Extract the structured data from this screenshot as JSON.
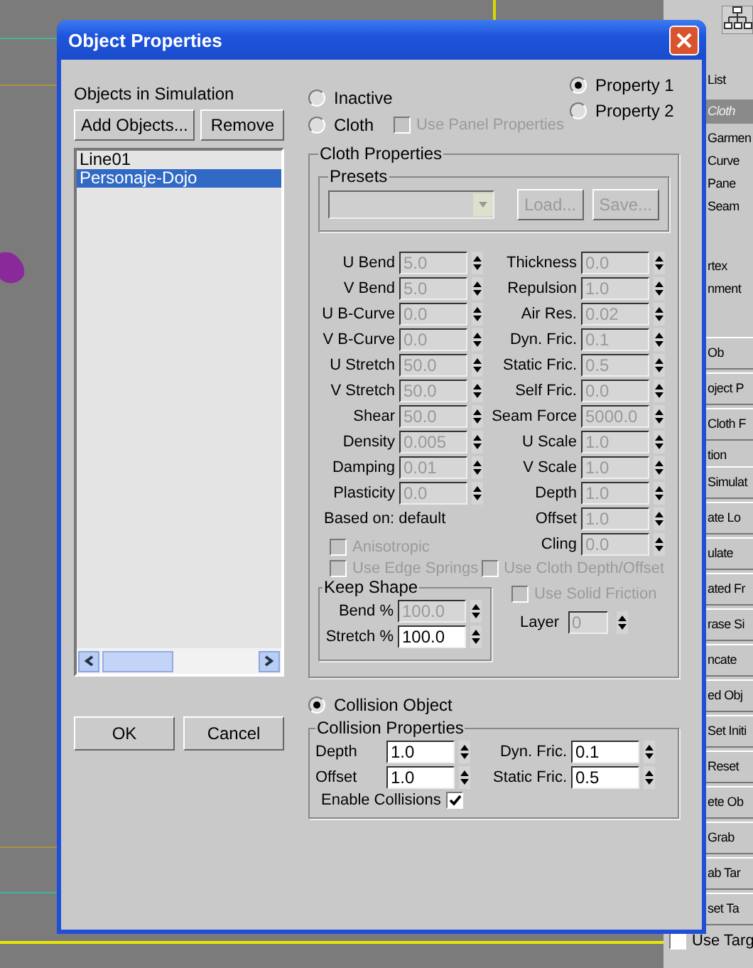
{
  "window": {
    "title": "Object Properties"
  },
  "objects": {
    "title": "Objects in Simulation",
    "buttons": [
      "Add Objects...",
      "Remove"
    ],
    "items": [
      {
        "label": "Line01",
        "selected": false
      },
      {
        "label": "Personaje-Dojo",
        "selected": true
      }
    ]
  },
  "dialog_buttons": [
    "OK",
    "Cancel"
  ],
  "mode_radios": [
    {
      "label": "Inactive",
      "selected": false
    },
    {
      "label": "Cloth",
      "selected": false
    },
    {
      "label": "Collision Object",
      "selected": true
    }
  ],
  "use_panel_properties": {
    "label": "Use Panel Properties",
    "checked": false,
    "disabled": true
  },
  "property_radios": [
    {
      "label": "Property 1",
      "selected": true
    },
    {
      "label": "Property 2",
      "selected": false
    }
  ],
  "cloth_properties": {
    "title": "Cloth Properties",
    "presets": {
      "title": "Presets",
      "buttons": [
        "Load...",
        "Save..."
      ]
    },
    "left_fields": [
      {
        "label": "U Bend",
        "value": "5.0",
        "disabled": true
      },
      {
        "label": "V Bend",
        "value": "5.0",
        "disabled": true
      },
      {
        "label": "U B-Curve",
        "value": "0.0",
        "disabled": true
      },
      {
        "label": "V B-Curve",
        "value": "0.0",
        "disabled": true
      },
      {
        "label": "U Stretch",
        "value": "50.0",
        "disabled": true
      },
      {
        "label": "V Stretch",
        "value": "50.0",
        "disabled": true
      },
      {
        "label": "Shear",
        "value": "50.0",
        "disabled": true
      },
      {
        "label": "Density",
        "value": "0.005",
        "disabled": true
      },
      {
        "label": "Damping",
        "value": "0.01",
        "disabled": true
      },
      {
        "label": "Plasticity",
        "value": "0.0",
        "disabled": true
      }
    ],
    "based_on": "Based on: default",
    "anisotropic": {
      "label": "Anisotropic",
      "checked": false,
      "disabled": true
    },
    "right_fields": [
      {
        "label": "Thickness",
        "value": "0.0",
        "disabled": true
      },
      {
        "label": "Repulsion",
        "value": "1.0",
        "disabled": true
      },
      {
        "label": "Air Res.",
        "value": "0.02",
        "disabled": true
      },
      {
        "label": "Dyn. Fric.",
        "value": "0.1",
        "disabled": true
      },
      {
        "label": "Static Fric.",
        "value": "0.5",
        "disabled": true
      },
      {
        "label": "Self Fric.",
        "value": "0.0",
        "disabled": true
      },
      {
        "label": "Seam Force",
        "value": "5000.0",
        "disabled": true
      },
      {
        "label": "U Scale",
        "value": "1.0",
        "disabled": true
      },
      {
        "label": "V Scale",
        "value": "1.0",
        "disabled": true
      },
      {
        "label": "Depth",
        "value": "1.0",
        "disabled": true
      },
      {
        "label": "Offset",
        "value": "1.0",
        "disabled": true
      },
      {
        "label": "Cling",
        "value": "0.0",
        "disabled": true
      }
    ],
    "edge_springs": {
      "label": "Use Edge Springs",
      "checked": false,
      "disabled": true
    },
    "cloth_depth_offset": {
      "label": "Use Cloth Depth/Offset",
      "checked": false,
      "disabled": true
    },
    "keep_shape": {
      "title": "Keep Shape",
      "fields": [
        {
          "label": "Bend %",
          "value": "100.0",
          "disabled": true
        },
        {
          "label": "Stretch %",
          "value": "100.0",
          "disabled": false
        }
      ]
    },
    "solid_friction": {
      "label": "Use Solid Friction",
      "checked": false,
      "disabled": true
    },
    "layer": {
      "label": "Layer",
      "value": "0",
      "disabled": true
    }
  },
  "collision_properties": {
    "title": "Collision Properties",
    "left_fields": [
      {
        "label": "Depth",
        "value": "1.0",
        "disabled": false
      },
      {
        "label": "Offset",
        "value": "1.0",
        "disabled": false
      }
    ],
    "right_fields": [
      {
        "label": "Dyn. Fric.",
        "value": "0.1",
        "disabled": false
      },
      {
        "label": "Static Fric.",
        "value": "0.5",
        "disabled": false
      }
    ],
    "enable_collisions": {
      "label": "Enable Collisions",
      "checked": true,
      "disabled": false
    }
  },
  "side_panel": [
    {
      "kind": "text",
      "label": "List"
    },
    {
      "kind": "header",
      "label": "Cloth"
    },
    {
      "kind": "text",
      "label": "Garmen"
    },
    {
      "kind": "text",
      "label": "Curve"
    },
    {
      "kind": "text",
      "label": "Pane"
    },
    {
      "kind": "text",
      "label": "Seam"
    },
    {
      "kind": "gap"
    },
    {
      "kind": "text",
      "label": "rtex"
    },
    {
      "kind": "text",
      "label": "nment"
    },
    {
      "kind": "gap"
    },
    {
      "kind": "button",
      "label": "Ob"
    },
    {
      "kind": "button",
      "label": "oject P"
    },
    {
      "kind": "button",
      "label": "Cloth F"
    },
    {
      "kind": "text",
      "label": "tion"
    },
    {
      "kind": "button",
      "label": "Simulat"
    },
    {
      "kind": "button",
      "label": "ate Lo"
    },
    {
      "kind": "button",
      "label": "ulate"
    },
    {
      "kind": "button",
      "label": "ated Fr"
    },
    {
      "kind": "button",
      "label": "rase Si"
    },
    {
      "kind": "button",
      "label": "ncate"
    },
    {
      "kind": "button",
      "label": "ed Obj"
    },
    {
      "kind": "button",
      "label": "Set Initi"
    },
    {
      "kind": "button",
      "label": "Reset"
    },
    {
      "kind": "button",
      "label": "ete Ob"
    },
    {
      "kind": "button",
      "label": "Grab"
    },
    {
      "kind": "button",
      "label": "ab Tar"
    },
    {
      "kind": "button",
      "label": "set Ta"
    },
    {
      "kind": "checkbox",
      "label": "Use Targ",
      "checked": false
    }
  ]
}
